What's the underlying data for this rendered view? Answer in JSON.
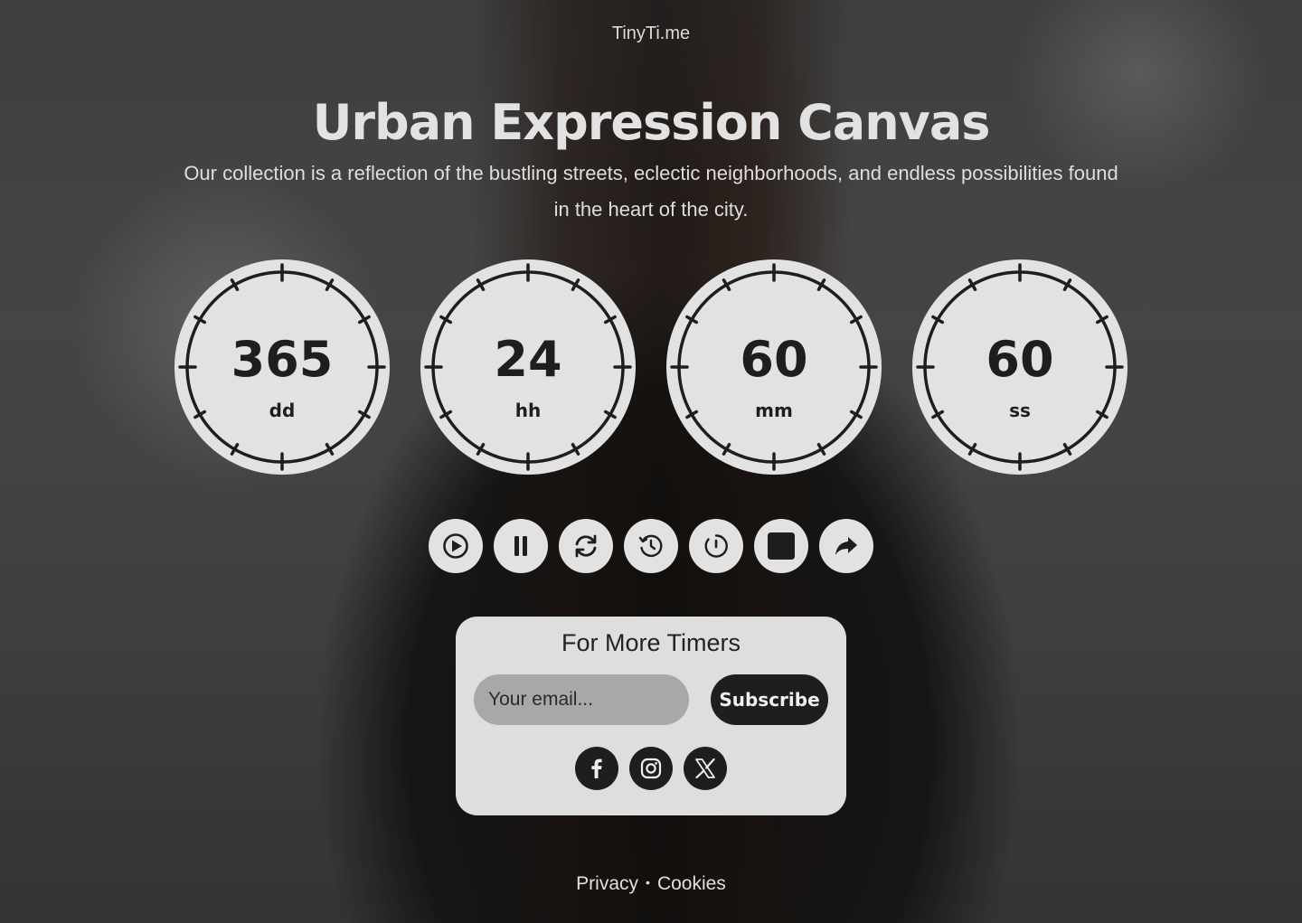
{
  "brand": "TinyTi.me",
  "hero": {
    "title": "Urban Expression Canvas",
    "subtitle": "Our collection is a reflection of the bustling streets, eclectic neighborhoods, and endless possibilities found in the heart of the city."
  },
  "dials": [
    {
      "value": "365",
      "unit": "dd"
    },
    {
      "value": "24",
      "unit": "hh"
    },
    {
      "value": "60",
      "unit": "mm"
    },
    {
      "value": "60",
      "unit": "ss"
    }
  ],
  "controls": [
    {
      "name": "play",
      "icon": "play-icon"
    },
    {
      "name": "pause",
      "icon": "pause-icon"
    },
    {
      "name": "restart",
      "icon": "refresh-icon"
    },
    {
      "name": "history",
      "icon": "history-icon"
    },
    {
      "name": "timer",
      "icon": "timer-icon"
    },
    {
      "name": "stop",
      "icon": "stop-icon"
    },
    {
      "name": "share",
      "icon": "share-icon"
    }
  ],
  "subscribe": {
    "title": "For More Timers",
    "email_placeholder": "Your email...",
    "button_label": "Subscribe",
    "socials": [
      "facebook-icon",
      "instagram-icon",
      "x-icon"
    ]
  },
  "footer": {
    "privacy": "Privacy",
    "separator": "•",
    "cookies": "Cookies"
  },
  "colors": {
    "dial_face": "#e2e2e2",
    "dial_ink": "#1e1e1e",
    "card_bg": "#dedede",
    "button_dark": "#1e1e1e",
    "input_bg": "#a8a8a8"
  }
}
